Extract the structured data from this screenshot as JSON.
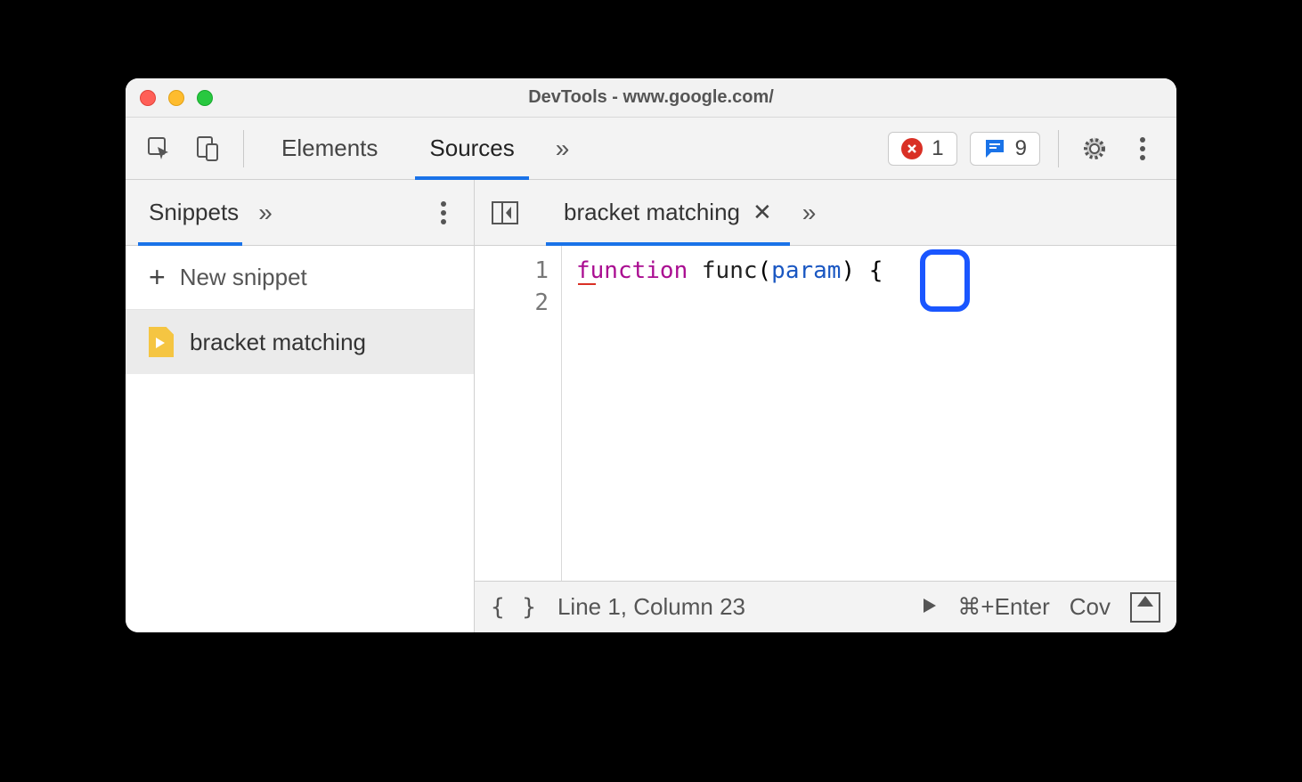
{
  "window": {
    "title": "DevTools - www.google.com/"
  },
  "toolbar": {
    "panel_tabs": {
      "elements": "Elements",
      "sources": "Sources"
    },
    "errors_count": "1",
    "messages_count": "9"
  },
  "sidebar": {
    "tab_label": "Snippets",
    "new_snippet_label": "New snippet",
    "items": [
      {
        "name": "bracket matching"
      }
    ]
  },
  "editor": {
    "tab_name": "bracket matching",
    "gutter": [
      "1",
      "2"
    ],
    "code": {
      "keyword": "function",
      "fn_name": "func",
      "open_paren": "(",
      "param": "param",
      "close_paren": ")",
      "space": " ",
      "brace": "{"
    }
  },
  "statusbar": {
    "format_label": "{ }",
    "position": "Line 1, Column 23",
    "run_shortcut": "⌘+Enter",
    "coverage": "Cov"
  }
}
